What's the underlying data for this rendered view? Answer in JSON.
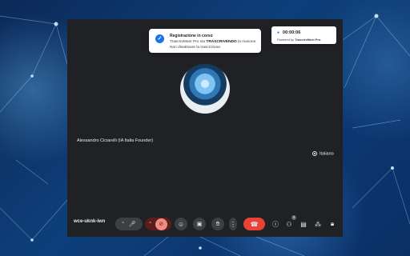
{
  "notification": {
    "title": "Registrazione in corso",
    "line1_prefix": "TrascrivMeet Pro sta ",
    "line1_bold": "TRASCRIVENDO",
    "line1_suffix": " la riunione.",
    "line2": "Non disattivare la trascrizione."
  },
  "timer": {
    "time": "00:00:06",
    "powered_prefix": "Powered by ",
    "powered_brand": "TrascrivMeet Pro"
  },
  "participant": {
    "name": "Alessandro Ciciarelli (IA Italia Founder)"
  },
  "captions": {
    "language": "Italiano"
  },
  "meeting": {
    "code": "wce-uknk-iwn",
    "participants_count": "3"
  },
  "colors": {
    "meet_bg": "#202124",
    "button_bg": "#3c4043",
    "end_call": "#ea4335",
    "accent": "#1a73e8"
  },
  "icons": [
    "check-icon",
    "record-dot-icon",
    "closed-captions-icon",
    "chevron-up-icon",
    "mic-icon",
    "camera-off-icon",
    "emoji-icon",
    "present-icon",
    "raise-hand-icon",
    "more-options-icon",
    "end-call-icon",
    "info-icon",
    "people-icon",
    "chat-icon",
    "activities-icon",
    "host-controls-icon"
  ]
}
